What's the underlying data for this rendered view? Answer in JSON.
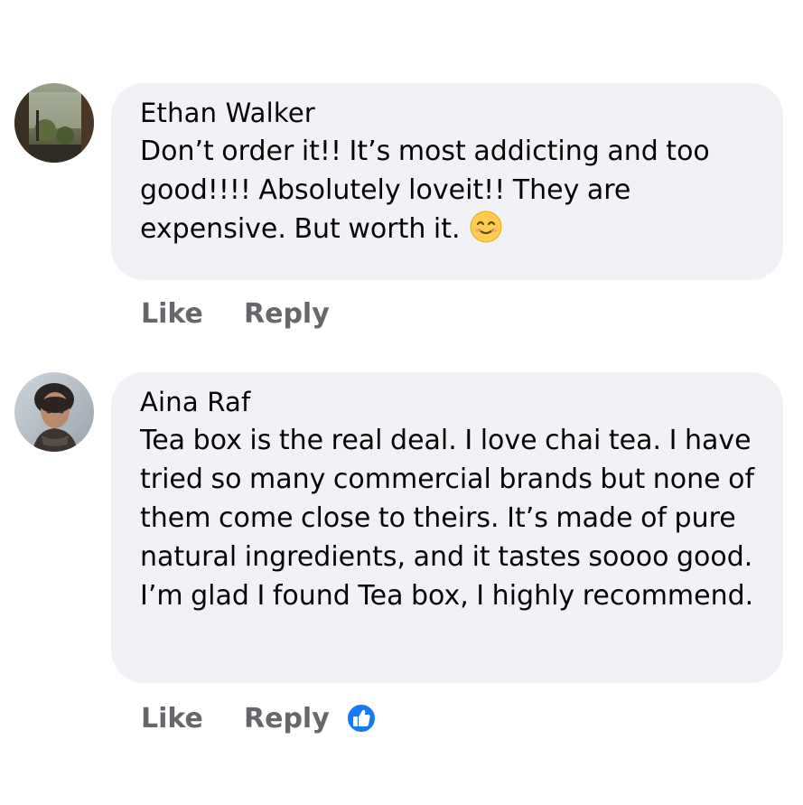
{
  "comments": [
    {
      "author": "Ethan Walker",
      "text": "Don’t order it!! It’s most addicting and too good!!!! Absolutely loveit!! They are expensive. But worth it.",
      "emoji": "smiling-face-emoji",
      "actions": {
        "like": "Like",
        "reply": "Reply"
      }
    },
    {
      "author": "Aina Raf",
      "text": "Tea box is the real deal. I love chai tea. I have tried so many commercial brands but none of them come close to theirs. It’s made of pure natural ingredients, and it tastes soooo good. I’m glad I found Tea box, I highly recommend.",
      "actions": {
        "like": "Like",
        "reply": "Reply"
      },
      "reaction": "like-reaction-icon"
    }
  ],
  "colors": {
    "bubble": "#f0f2f5",
    "action_text": "#65676b",
    "like_blue": "#1877f2",
    "emoji_yellow": "#ffcc4d"
  }
}
